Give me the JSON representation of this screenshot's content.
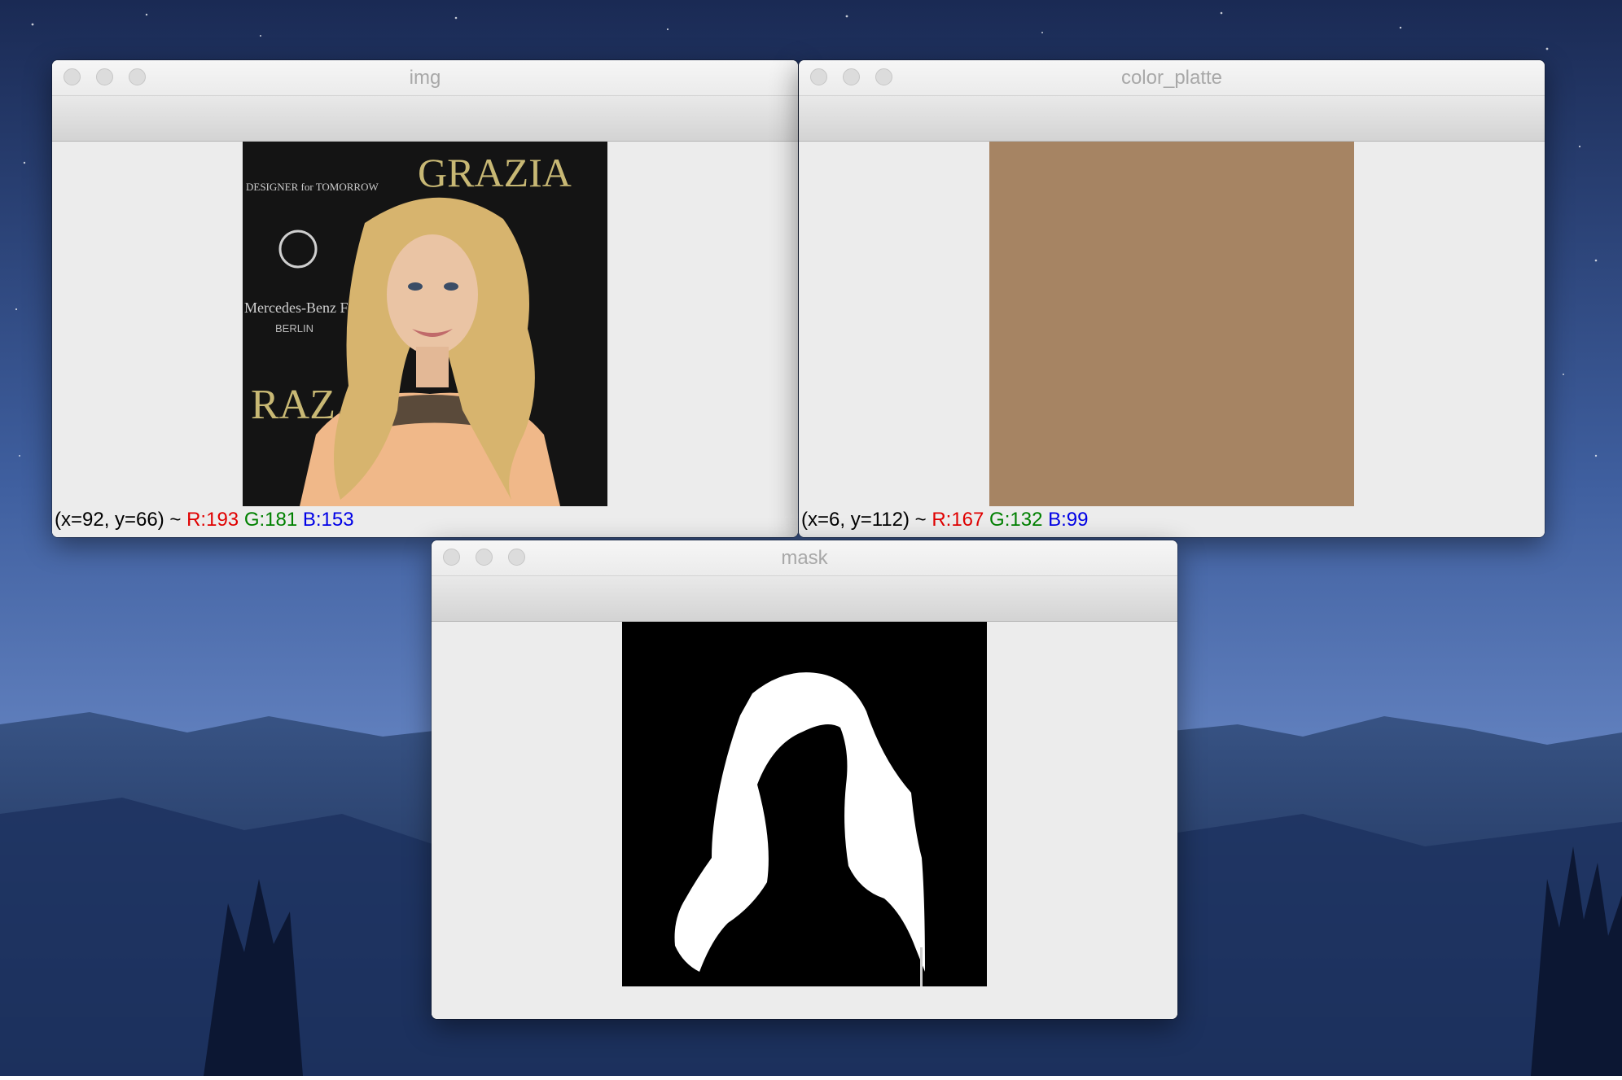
{
  "desktop": {
    "sky_top": "#1b2b55",
    "sky_bottom": "#6e8cc6",
    "mountain": "#243c6c"
  },
  "windows": {
    "img": {
      "title": "img",
      "photo_caption_top": "GRAZIA",
      "photo_caption_designer": "DESIGNER for TOMORROW",
      "photo_caption_left": "Mercedes-Benz FashionWeek BERLIN",
      "photo_caption_berlin": "BERLIN",
      "photo_caption_bottom": "RAZ",
      "status": {
        "coords": "(x=92, y=66) ~ ",
        "r": "R:193",
        "g": "G:181",
        "b": "B:153"
      }
    },
    "color_platte": {
      "title": "color_platte",
      "swatch_color": "#a68463",
      "status": {
        "coords": "(x=6, y=112) ~ ",
        "r": "R:167",
        "g": "G:132",
        "b": "B:99"
      }
    },
    "mask": {
      "title": "mask"
    }
  }
}
